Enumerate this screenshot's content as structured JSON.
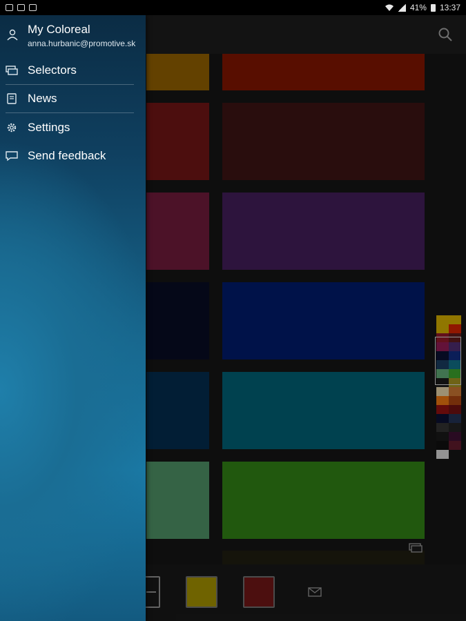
{
  "status_bar": {
    "battery": "41%",
    "time": "13:37"
  },
  "drawer": {
    "account": {
      "title": "My Coloreal",
      "email": "anna.hurbanic@promotive.sk"
    },
    "items": [
      {
        "label": "Selectors",
        "icon": "selector-card-icon"
      },
      {
        "label": "News",
        "icon": "book-icon"
      },
      {
        "label": "Settings",
        "icon": "gear-icon"
      },
      {
        "label": "Send feedback",
        "icon": "chat-bubble-icon"
      }
    ]
  },
  "swatches": {
    "colors": [
      "#8a5a00",
      "#7a1400",
      "#6a1414",
      "#3a1212",
      "#6a1a38",
      "#3f1c55",
      "#080c22",
      "#001a66",
      "#032a4a",
      "#005a6e",
      "#4a8a60",
      "#2e7a14"
    ]
  },
  "palette": {
    "rows": [
      [
        "#c8a400",
        "#c8a400"
      ],
      [
        "#c8a400",
        "#c82000"
      ],
      [
        "#8a1828",
        "#5a1a1a"
      ],
      [
        "#8a1a50",
        "#4a2a6a"
      ],
      [
        "#0a1030",
        "#102a7a"
      ],
      [
        "#183a5a",
        "#106a80"
      ],
      [
        "#5aa070",
        "#3a9a2a"
      ],
      [
        "#181818",
        "#9a8a20"
      ],
      [
        "#d8c8a0",
        "#c07030"
      ],
      [
        "#e07010",
        "#a04010"
      ],
      [
        "#8a1010",
        "#6a1010"
      ],
      [
        "#0a1030",
        "#203050"
      ],
      [
        "#303030",
        "#202020"
      ],
      [
        "#181818",
        "#3a1030"
      ],
      [
        "#101010",
        "#5a1a2a"
      ],
      [
        "#cccccc",
        "#141414"
      ]
    ]
  },
  "bottom_bar": {
    "selected_colors": [
      "#9a8a00",
      "#6a1616"
    ]
  },
  "colors": {
    "app_bar": "#1b1b1b",
    "drawer_top": "#0b2c44",
    "drawer_mid": "#1a7aa6"
  }
}
